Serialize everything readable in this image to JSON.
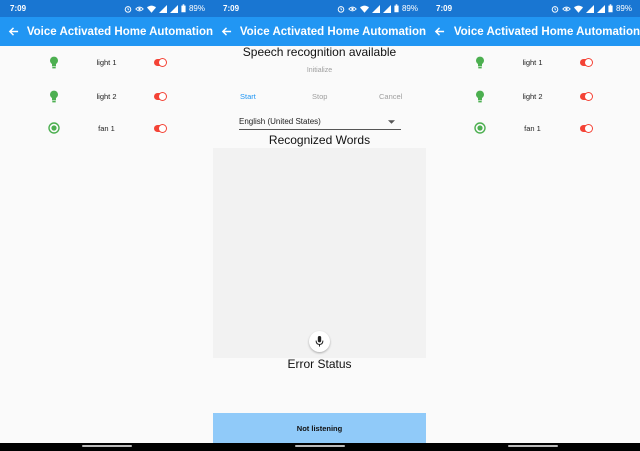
{
  "status_bar": {
    "time": "7:09",
    "battery": "89%"
  },
  "app_title": "Voice Activated Home Automation",
  "colors": {
    "primary": "#2196f3",
    "status": "#1976d2",
    "green": "#4caf50",
    "red": "#f44336",
    "listen_bar": "#90caf9",
    "link_blue": "#2196f3"
  },
  "devices": [
    {
      "label": "light 1",
      "icon": "lightbulb-icon"
    },
    {
      "label": "light 2",
      "icon": "lightbulb-icon"
    },
    {
      "label": "fan 1",
      "icon": "radio-on-icon"
    }
  ],
  "speech": {
    "availability": "Speech recognition available",
    "initialize": "Initialize",
    "start": "Start",
    "stop": "Stop",
    "cancel": "Cancel",
    "language": "English (United States)",
    "recognized_words_heading": "Recognized Words",
    "error_status_heading": "Error Status",
    "listening_status": "Not listening"
  }
}
